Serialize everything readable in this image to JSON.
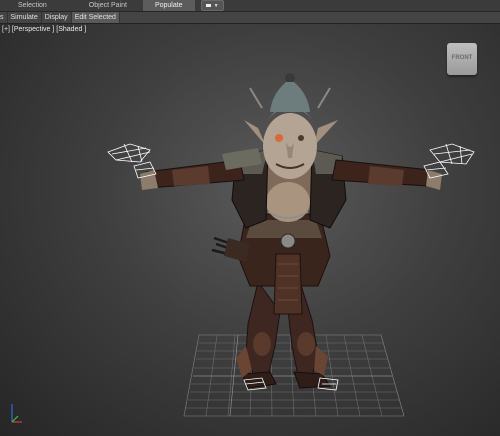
{
  "ribbon": {
    "tabs": [
      {
        "label": "Selection",
        "active": false
      },
      {
        "label": "Object Paint",
        "active": false
      },
      {
        "label": "Populate",
        "active": true
      }
    ]
  },
  "menu": {
    "items": [
      {
        "label": "s",
        "active": false
      },
      {
        "label": "Simulate",
        "active": false
      },
      {
        "label": "Display",
        "active": false
      },
      {
        "label": "Edit Selected",
        "active": true
      }
    ]
  },
  "viewport": {
    "label": "[+] [Perspective ] [Shaded ]",
    "viewcube_label": "FRONT"
  },
  "colors": {
    "accent_tab": "#5c5c5c",
    "viewport_bg": "#3f3f3f",
    "skin": "#b4a99a",
    "armor": "#4a2f24"
  },
  "icons": [
    "viewport-layout-icon",
    "view-cube-icon",
    "axis-tripod-icon"
  ]
}
